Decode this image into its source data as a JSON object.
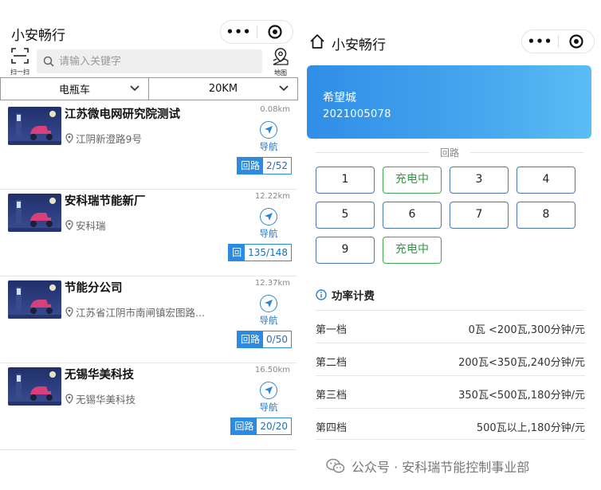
{
  "left": {
    "title": "小安畅行",
    "scan_label": "扫一扫",
    "search_placeholder": "请输入关键字",
    "map_label": "地图",
    "filters": {
      "vehicle": "电瓶车",
      "distance": "20KM"
    },
    "stations": [
      {
        "name": "江苏微电网研究院测试",
        "distance": "0.08km",
        "address": "江阴新澄路9号",
        "nav_label": "导航",
        "loop_label": "回路",
        "loop_value": "2/52"
      },
      {
        "name": "安科瑞节能新厂",
        "distance": "12.22km",
        "address": "安科瑞",
        "nav_label": "导航",
        "loop_label": "回",
        "loop_value": "135/148"
      },
      {
        "name": "节能分公司",
        "distance": "12.37km",
        "address": "江苏省江阴市南闸镇宏图路...",
        "nav_label": "导航",
        "loop_label": "回路",
        "loop_value": "0/50"
      },
      {
        "name": "无锡华美科技",
        "distance": "16.50km",
        "address": "无锡华美科技",
        "nav_label": "导航",
        "loop_label": "回路",
        "loop_value": "20/20"
      }
    ]
  },
  "right": {
    "title": "小安畅行",
    "card": {
      "name": "希望城",
      "code": "2021005078"
    },
    "loops_label": "回路",
    "loops": [
      {
        "label": "1",
        "status": "idle"
      },
      {
        "label": "充电中",
        "status": "charging"
      },
      {
        "label": "3",
        "status": "idle"
      },
      {
        "label": "4",
        "status": "idle"
      },
      {
        "label": "5",
        "status": "idle"
      },
      {
        "label": "6",
        "status": "idle"
      },
      {
        "label": "7",
        "status": "idle"
      },
      {
        "label": "8",
        "status": "idle"
      },
      {
        "label": "9",
        "status": "idle"
      },
      {
        "label": "充电中",
        "status": "charging"
      }
    ],
    "fee_title": "功率计费",
    "fees": [
      {
        "tier": "第一档",
        "price": "0瓦 <200瓦,300分钟/元"
      },
      {
        "tier": "第二档",
        "price": "200瓦<350瓦,240分钟/元"
      },
      {
        "tier": "第三档",
        "price": "350瓦<500瓦,180分钟/元"
      },
      {
        "tier": "第四档",
        "price": "500瓦以上,180分钟/元"
      }
    ]
  },
  "watermark": "公众号 · 安科瑞节能控制事业部",
  "colors": {
    "accent": "#2c8be0",
    "charging": "#3daa52",
    "card_start": "#2f8ee6",
    "card_end": "#5bbdf4"
  },
  "icons": [
    "scan-icon",
    "search-icon",
    "map-pin-icon",
    "chevron-down-icon",
    "location-pin-icon",
    "navigation-icon",
    "home-icon",
    "more-dots-icon",
    "target-icon",
    "info-icon",
    "wechat-icon"
  ]
}
